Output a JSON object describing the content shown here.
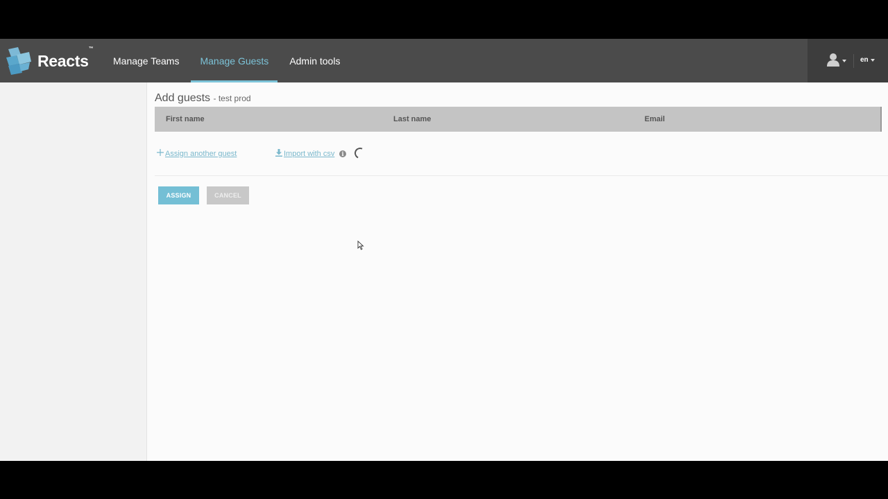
{
  "brand": {
    "name": "Reacts",
    "tm": "™"
  },
  "nav": {
    "items": [
      {
        "label": "Manage Teams",
        "active": false
      },
      {
        "label": "Manage Guests",
        "active": true
      },
      {
        "label": "Admin tools",
        "active": false
      }
    ]
  },
  "topbar_right": {
    "language": "en"
  },
  "page": {
    "title": "Add guests",
    "subtitle": "- test prod"
  },
  "table": {
    "columns": [
      "First name",
      "Last name",
      "Email"
    ]
  },
  "actions": {
    "assign_another": "Assign another guest",
    "import_csv": "Import with csv"
  },
  "buttons": {
    "assign": "ASSIGN",
    "cancel": "CANCEL"
  },
  "colors": {
    "topbar": "#4b4b4b",
    "accent": "#7cc3d8",
    "assign_button": "#74bfd5",
    "table_header": "#c4c4c4"
  }
}
